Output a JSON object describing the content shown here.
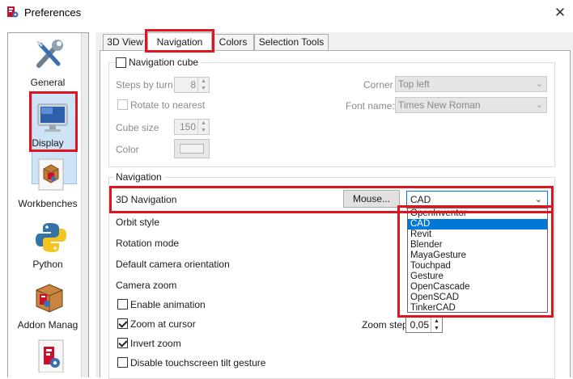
{
  "window": {
    "title": "Preferences",
    "close_glyph": "✕"
  },
  "sidebar": {
    "items": [
      {
        "label": "General",
        "icon": "wrench-screwdriver-icon"
      },
      {
        "label": "Display",
        "icon": "monitor-icon"
      },
      {
        "label": "Workbenches",
        "icon": "workbench-box-icon"
      },
      {
        "label": "Python",
        "icon": "python-icon"
      },
      {
        "label": "Addon Manag",
        "icon": "addon-box-icon"
      },
      {
        "label": "",
        "icon": "freecad-file-icon"
      }
    ],
    "selected": "Display"
  },
  "tabs": [
    {
      "label": "3D View"
    },
    {
      "label": "Navigation",
      "active": true
    },
    {
      "label": "Colors"
    },
    {
      "label": "Selection Tools"
    }
  ],
  "nav_cube": {
    "group_label": "Navigation cube",
    "steps_label": "Steps by turn",
    "steps_value": "8",
    "rotate_label": "Rotate to nearest",
    "cube_size_label": "Cube size",
    "cube_size_value": "150",
    "color_label": "Color",
    "corner_label": "Corner",
    "corner_value": "Top left",
    "font_label": "Font name:",
    "font_value": "Times New Roman"
  },
  "navigation": {
    "group_label": "Navigation",
    "nav3d_label": "3D Navigation",
    "mouse_button": "Mouse...",
    "nav3d_value": "CAD",
    "options": [
      "OpenInventor",
      "CAD",
      "Revit",
      "Blender",
      "MayaGesture",
      "Touchpad",
      "Gesture",
      "OpenCascade",
      "OpenSCAD",
      "TinkerCAD"
    ],
    "selected_option": "CAD",
    "orbit_label": "Orbit style",
    "rotation_label": "Rotation mode",
    "camera_orientation_label": "Default camera orientation",
    "camera_zoom_label": "Camera zoom",
    "enable_animation_label": "Enable animation",
    "zoom_cursor_label": "Zoom at cursor",
    "zoom_step_label": "Zoom step",
    "zoom_step_value": "0,05",
    "invert_zoom_label": "Invert zoom",
    "disable_tilt_label": "Disable touchscreen tilt gesture"
  },
  "colors": {
    "highlight": "#e0141e",
    "selection": "#0078d7"
  }
}
